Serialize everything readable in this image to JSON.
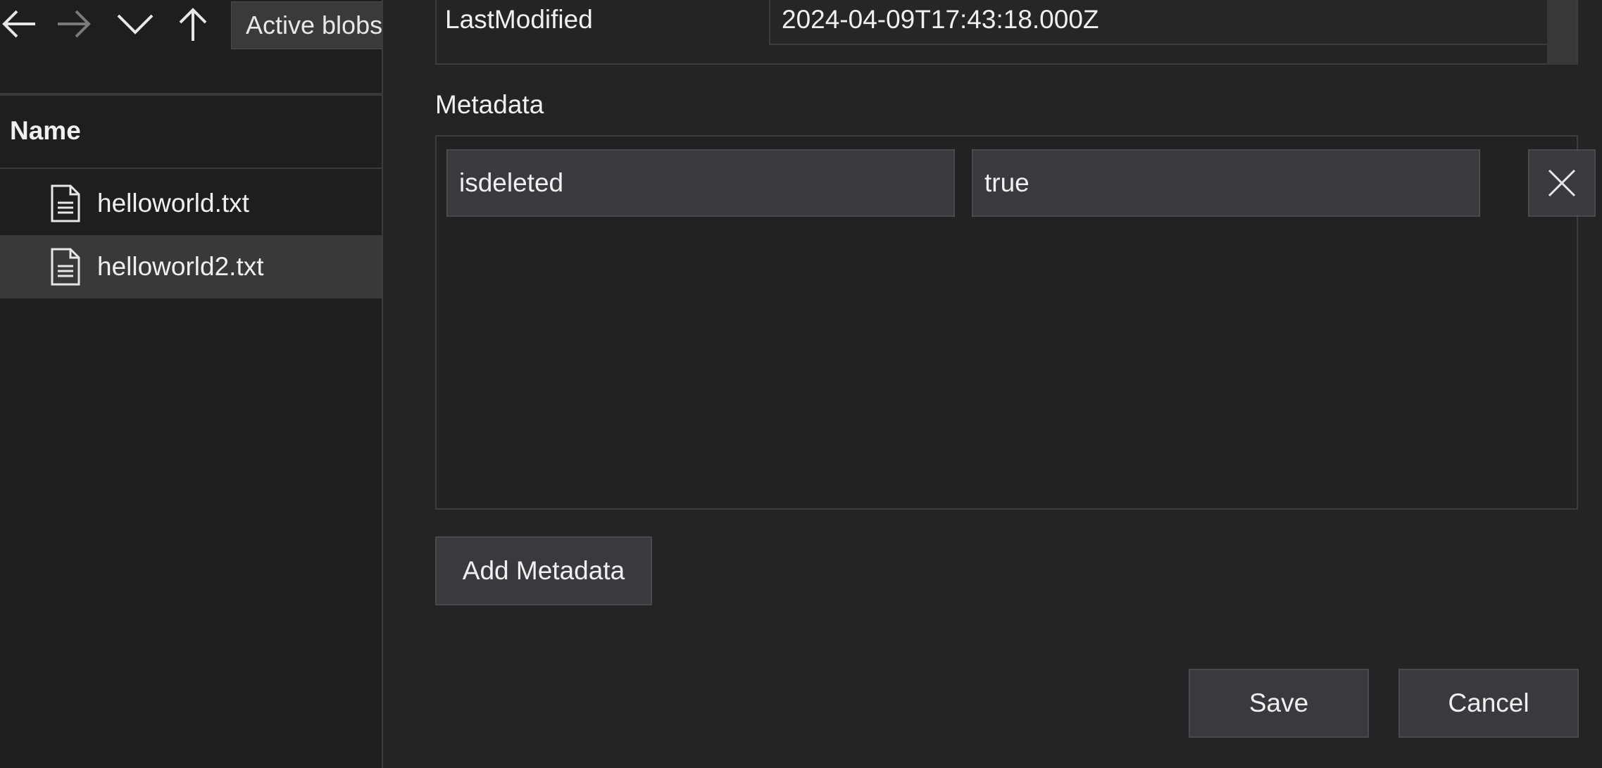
{
  "explorer": {
    "nav": {
      "back_icon": "arrow-left-icon",
      "forward_icon": "arrow-right-icon",
      "recent_icon": "chevron-down-icon",
      "up_icon": "arrow-up-icon"
    },
    "address_text": "Active blobs",
    "column_header": "Name",
    "files": [
      {
        "name": "helloworld.txt",
        "icon": "document-icon",
        "selected": false
      },
      {
        "name": "helloworld2.txt",
        "icon": "document-icon",
        "selected": true
      }
    ]
  },
  "dialog": {
    "properties": [
      {
        "key": "LastModified",
        "value": "2024-04-09T17:43:18.000Z"
      }
    ],
    "metadata_label": "Metadata",
    "metadata": [
      {
        "key": "isdeleted",
        "value": "true",
        "remove_icon": "close-icon"
      }
    ],
    "add_metadata_label": "Add Metadata",
    "save_label": "Save",
    "cancel_label": "Cancel"
  },
  "colors": {
    "background": "#1e1e1e",
    "panel": "#242424",
    "control": "#3a3a3e",
    "border": "#4a4a4e",
    "selected_row": "#393939",
    "text": "#f0f0f0"
  }
}
